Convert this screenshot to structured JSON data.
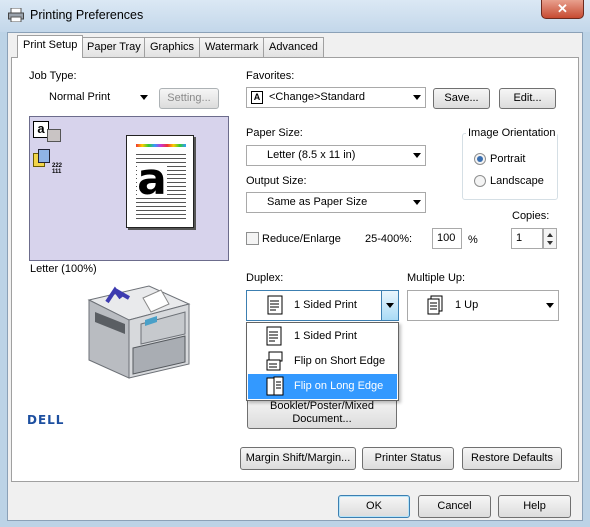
{
  "window": {
    "title": "Printing Preferences",
    "close_glyph": "✕"
  },
  "tabs": [
    {
      "label": "Print Setup",
      "active": true
    },
    {
      "label": "Paper Tray"
    },
    {
      "label": "Graphics"
    },
    {
      "label": "Watermark"
    },
    {
      "label": "Advanced"
    }
  ],
  "job_type": {
    "label": "Job Type:",
    "value": "Normal Print",
    "setting_button": "Setting..."
  },
  "favorites": {
    "label": "Favorites:",
    "value": "<Change>Standard",
    "icon_glyph": "A",
    "save_button": "Save...",
    "edit_button": "Edit..."
  },
  "preview": {
    "caption": "Letter (100%)",
    "letter_glyph": "a",
    "stack_count_label": "222\n111"
  },
  "paper_size": {
    "label": "Paper Size:",
    "value": "Letter (8.5 x 11 in)"
  },
  "output_size": {
    "label": "Output Size:",
    "value": "Same as Paper Size"
  },
  "image_orientation": {
    "label": "Image Orientation",
    "options": [
      "Portrait",
      "Landscape"
    ],
    "selected": "Portrait"
  },
  "copies": {
    "label": "Copies:",
    "value": "1"
  },
  "reduce_enlarge": {
    "label": "Reduce/Enlarge",
    "range": "25-400%:",
    "value": "100",
    "unit": "%",
    "checked": false
  },
  "duplex": {
    "label": "Duplex:",
    "value": "1 Sided Print",
    "options": [
      "1 Sided Print",
      "Flip on Short Edge",
      "Flip on Long Edge"
    ],
    "highlighted": "Flip on Long Edge"
  },
  "multiple_up": {
    "label": "Multiple Up:",
    "value": "1 Up"
  },
  "booklet_button": {
    "line1": "Booklet/Poster/Mixed",
    "line2": "Document..."
  },
  "brand": {
    "logo_text": "DELL"
  },
  "bottom_buttons": {
    "margin_shift": "Margin Shift/Margin...",
    "printer_status": "Printer Status",
    "restore_defaults": "Restore Defaults"
  },
  "dialog_buttons": {
    "ok": "OK",
    "cancel": "Cancel",
    "help": "Help"
  },
  "colors": {
    "selection": "#3399ff",
    "preview_bg": "#d7d3ec",
    "printer_arrow": "#3d3bb0"
  }
}
